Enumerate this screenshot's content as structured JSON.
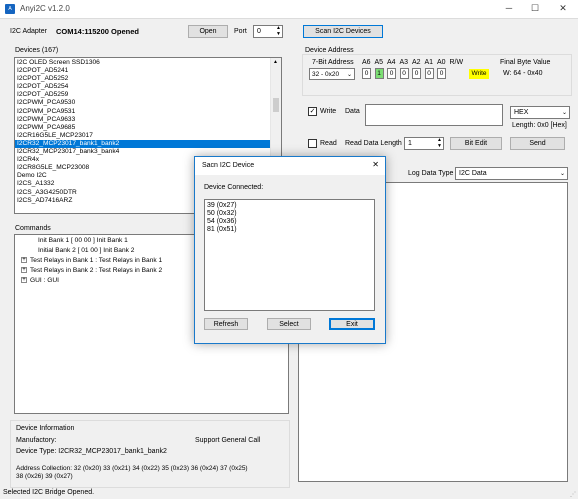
{
  "window": {
    "title": "Anyi2C v1.2.0",
    "minimize": "─",
    "maximize": "☐",
    "close": "✕"
  },
  "header": {
    "adapter_label": "I2C Adapter",
    "status": "COM14:115200 Opened",
    "open_label": "Open",
    "port_label": "Port",
    "port_value": "0",
    "scan_label": "Scan I2C Devices"
  },
  "devices": {
    "label": "Devices (167)",
    "items": [
      "I2C OLED Screen SSD1306",
      "I2CPOT_AD5241",
      "I2CPOT_AD5252",
      "I2CPOT_AD5254",
      "I2CPOT_AD5259",
      "I2CPWM_PCA9530",
      "I2CPWM_PCA9531",
      "I2CPWM_PCA9633",
      "I2CPWM_PCA9685",
      "I2CR16G5LE_MCP23017",
      "I2CR32_MCP23017_bank1_bank2",
      "I2CR32_MCP23017_bank3_bank4",
      "I2CR4x",
      "I2CR8G5LE_MCP23008",
      "Demo I2C",
      "I2CS_A1332",
      "I2CS_A3G4250DTR",
      "I2CS_AD7416ARZ"
    ],
    "selected_index": 10
  },
  "commands": {
    "label": "Commands",
    "items": [
      {
        "text": "Init Bank 1 [ 00 00 ]  Init Bank 1",
        "expandable": false
      },
      {
        "text": "Initial Bank 2 [ 01 00 ]  Init Bank 2",
        "expandable": false
      },
      {
        "text": "Test Relays in Bank 1 : Test Relays in Bank 1",
        "expandable": true
      },
      {
        "text": "Test Relays in Bank 2 : Test Relays in Bank 2",
        "expandable": true
      },
      {
        "text": "GUI : GUI",
        "expandable": true
      }
    ]
  },
  "device_info": {
    "label": "Device Information",
    "manufactory": "Manufactory:",
    "support": "Support General Call",
    "type": "Device Type: I2CR32_MCP23017_bank1_bank2",
    "addresses_line1": "Address Collection: 32 (0x20)  33 (0x21)  34 (0x22)  35 (0x23)  36 (0x24)  37 (0x25)",
    "addresses_line2": "38 (0x26)  39 (0x27)"
  },
  "status_bar": {
    "text": "Selected I2C Bridge Opened."
  },
  "address": {
    "label": "Device Address",
    "bit7_label": "7-Bit Address",
    "bit7_value": "32 - 0x20",
    "bit_labels": [
      "A6",
      "A5",
      "A4",
      "A3",
      "A2",
      "A1",
      "A0",
      "R/W"
    ],
    "bits": [
      "0",
      "1",
      "0",
      "0",
      "0",
      "0",
      "0"
    ],
    "write_label": "Write",
    "final_label": "Final Byte Value",
    "final_value": "W: 64 - 0x40"
  },
  "write_row": {
    "label": "Write",
    "checked": true,
    "data_label": "Data",
    "format": "HEX",
    "length_text": "Length: 0x0 [Hex]"
  },
  "read_row": {
    "label": "Read",
    "checked": false,
    "length_label": "Read Data Length",
    "length_value": "1",
    "bit_edit": "Bit Edit",
    "send": "Send"
  },
  "log": {
    "label": "Log Data Type",
    "value": "I2C Data"
  },
  "dialog": {
    "title": "Sacn I2C Device",
    "close": "✕",
    "connected_label": "Device Connected:",
    "lines": [
      "39  (0x27)",
      "50  (0x32)",
      "54  (0x36)",
      "81  (0x51)"
    ],
    "refresh": "Refresh",
    "select": "Select",
    "exit": "Exit"
  },
  "colors": {
    "accent": "#0078d7",
    "selection": "#0078d7",
    "bit_on": "#7cde74",
    "write_highlight": "#ffff00"
  }
}
